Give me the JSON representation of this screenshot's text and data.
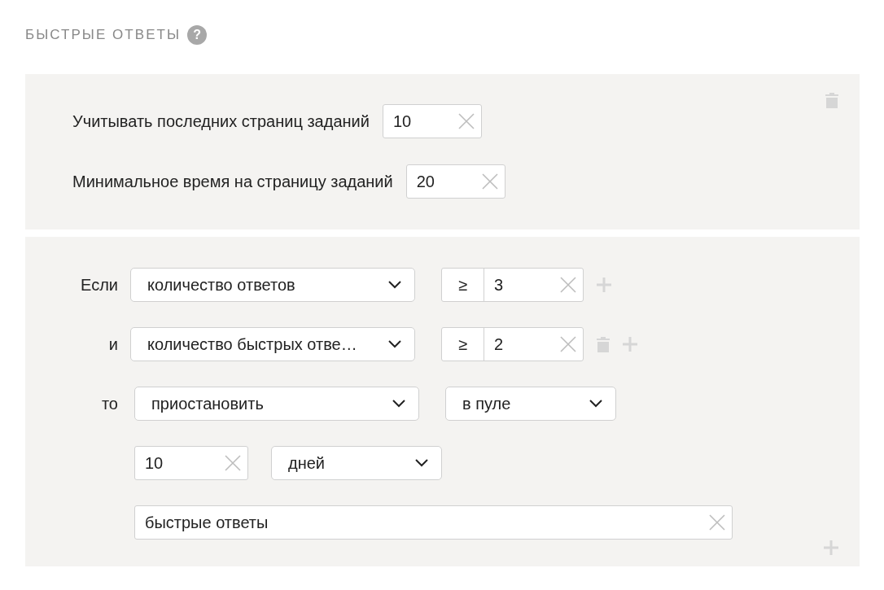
{
  "section_title": "БЫСТРЫЕ ОТВЕТЫ",
  "help": "?",
  "settings": [
    {
      "label": "Учитывать последних страниц заданий",
      "value": "10"
    },
    {
      "label": "Минимальное время на страницу заданий",
      "value": "20"
    }
  ],
  "conditions": [
    {
      "connector": "Если",
      "metric": "количество ответов",
      "operator": "≥",
      "value": "3",
      "deletable": false
    },
    {
      "connector": "и",
      "metric": "количество быстрых отве…",
      "operator": "≥",
      "value": "2",
      "deletable": true
    }
  ],
  "action": {
    "connector": "то",
    "action": "приостановить",
    "scope": "в пуле"
  },
  "duration": {
    "value": "10",
    "unit": "дней"
  },
  "tag": {
    "value": "быстрые ответы"
  }
}
